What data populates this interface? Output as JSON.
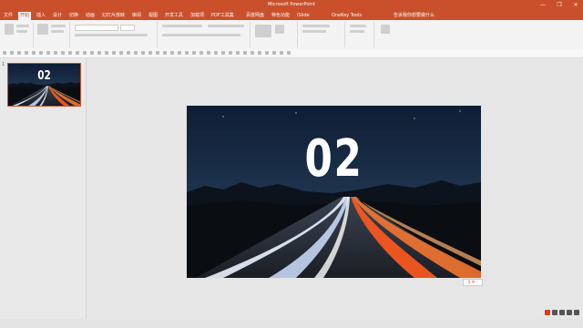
{
  "app": {
    "title": "Microsoft PowerPoint"
  },
  "tabs": [
    "文件",
    "开始",
    "插入",
    "设计",
    "切换",
    "动画",
    "幻灯片放映",
    "审阅",
    "视图",
    "开发工具",
    "加载项",
    "PDF工具集",
    "百度网盘",
    "特色功能",
    "iSlide",
    "OneKey Tools",
    "告诉我你想要做什么"
  ],
  "active_tab_index": 1,
  "slide_panel": {
    "slide_number": "1"
  },
  "slide": {
    "title": "02"
  },
  "watermark": {
    "text": "S 中 ·"
  },
  "window_controls": {
    "minimize": "—",
    "restore": "❐",
    "close": "✕"
  },
  "colors": {
    "accent": "#c9502a",
    "sky_top": "#0e1d34",
    "road": "#2a2f38",
    "light_orange": "#ff5a1e",
    "light_white": "#e9f2ff"
  }
}
